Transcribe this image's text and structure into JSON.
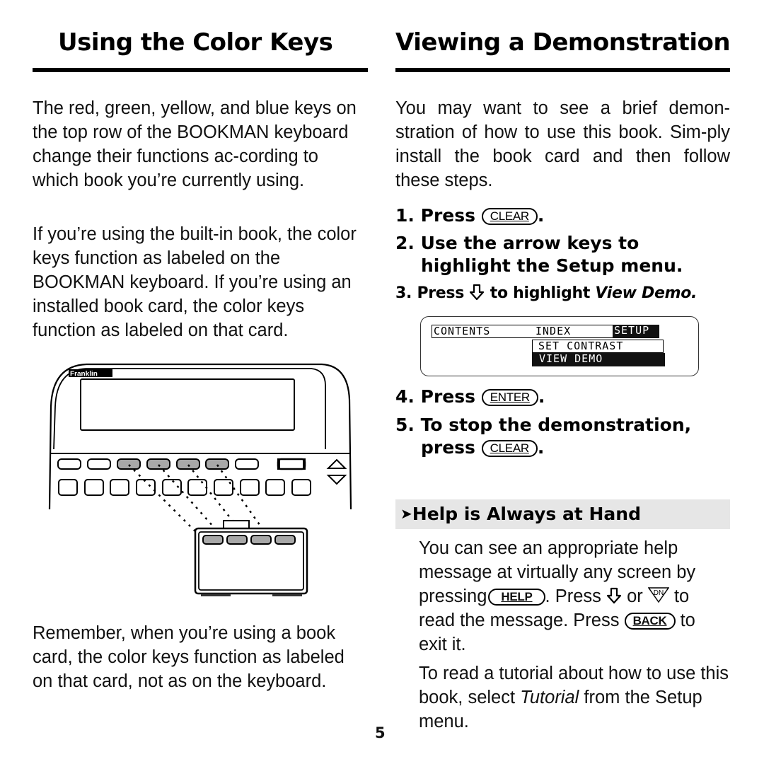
{
  "left_column": {
    "title": "Using the Color Keys",
    "para1": "The red, green, yellow, and blue keys on the top row of the BOOKMAN keyboard change their functions ac-cording to which book you’re currently using.",
    "para2": "If you’re using the built-in book, the color keys function as labeled on the BOOKMAN keyboard. If you’re using an installed book card, the color keys function as labeled on that card.",
    "para3": "Remember, when you’re using a book card, the color keys function as labeled on that card, not as on the keyboard.",
    "illustration": {
      "brand_label": "Franklin",
      "description": "BOOKMAN device with color keys linked to book card keys"
    }
  },
  "right_column": {
    "title": "Viewing a Demonstration",
    "intro": "You may want to see a brief demon-stration of how to use this book. Sim-ply install the book card and then follow these steps.",
    "steps": [
      {
        "num": "1.",
        "text_before": "Press",
        "key": "CLEAR",
        "text_after": "."
      },
      {
        "num": "2.",
        "line1": "Use the arrow keys to",
        "line2": "highlight the Setup menu."
      },
      {
        "num": "3.",
        "text_before": "Press",
        "icon": "down-arrow-icon",
        "text_mid": "to highlight",
        "italic": "View Demo."
      },
      {
        "num": "4.",
        "text_before": "Press",
        "key": "ENTER",
        "text_after": "."
      },
      {
        "num": "5.",
        "line1": "To stop the demonstration,",
        "line2_before": "press",
        "key": "CLEAR",
        "text_after": "."
      }
    ],
    "screen": {
      "menu_contents": "CONTENTS",
      "menu_index": "INDEX",
      "menu_setup": "SETUP",
      "item_set_contrast": "SET CONTRAST",
      "item_view_demo": "VIEW DEMO"
    },
    "callout": {
      "arrow": "➤",
      "title": "Help is Always at Hand",
      "para1": {
        "line1": "You can see an appropriate help",
        "line2": "message at virtually any screen by",
        "pressing": "pressing",
        "help_key": "HELP",
        "press": ". Press",
        "or": "or",
        "dn_key": "DN",
        "to": "to",
        "line4_before": "read the message. Press",
        "back_key": "BACK",
        "line4_after": "to",
        "line5": "exit it."
      },
      "para2": {
        "before": "To read a tutorial about how to use this book, select",
        "italic": "Tutorial",
        "after": "from the Setup menu."
      }
    }
  },
  "page_number": "5",
  "colors": {
    "text": "#111111",
    "rule": "#000000",
    "callout_bg": "#e6e6e6",
    "color_key_fill": "#a8a8a8",
    "lcd_highlight": "#111111"
  }
}
